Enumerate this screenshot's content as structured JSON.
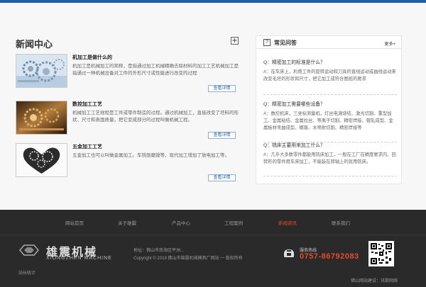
{
  "news": {
    "title": "新闻中心",
    "plus_symbol": "+",
    "items": [
      {
        "title": "机加工是做什么的",
        "description": "机加工是机械加工的简称，是指通过加工机械精确去除材料的加工工艺机械加工是指通过一种机械设备对工件的外形尺寸或性能进行改变的过程",
        "more_label": "查看详情"
      },
      {
        "title": "数控加工工艺",
        "description": "机械加工工艺规程是工件或零件制造的过程。通过机械加工，直接改变了坯料的形状、尺寸和表面质量，把它变成部分的过程叫做机械工程。",
        "more_label": "查看详情"
      },
      {
        "title": "五金加工工艺",
        "description": "五金加工也可以叫做金属加工。车铣刨磨镗等，现代加工增加了放电加工等。",
        "more_label": "查看详情"
      }
    ]
  },
  "faq": {
    "icon_symbol": "?",
    "title": "常见问答",
    "more_label": "更多+",
    "items": [
      {
        "question": "Q：精密加工的标准是什么？",
        "answer": "A：在车床上，利用工件的旋转运动和刀具的直线运动或曲线运动来改变毛坯的形状和尺寸，把它加工成符合图纸的要求"
      },
      {
        "question": "Q：精密加工需要哪些设备？",
        "answer": "A：数控机床，三坐标测量机，灯丝电源烧结、激光切割、重型加工、金属粘结、金属拉丝、等离子切割、精密焊接、辊轧成型、金属板材弯曲成型、模锻、水喷射切割、精密焊接等"
      },
      {
        "question": "Q：铣床主要用来加工什么？",
        "answer": "A：几乎大多数零件都能用铣床加工，一般在工厂在精度要求内，回转形的零件用车床加工，不能装在转轴上的就用铣床。"
      }
    ]
  },
  "footer": {
    "nav": [
      {
        "label": "网站首页",
        "active": false
      },
      {
        "label": "关于雄震",
        "active": false
      },
      {
        "label": "产品中心",
        "active": false
      },
      {
        "label": "工程案例",
        "active": false
      },
      {
        "label": "新闻资讯",
        "active": true
      },
      {
        "label": "联系我们",
        "active": false
      }
    ],
    "logo_cn": "雄震机械",
    "logo_en": "XIONGZHEN MACHINE",
    "address": "地址：佛山市南海区平洲...",
    "copyright": "Copyright © 2018  佛山市雄震机械模具厂网站  一 版权所有",
    "hotline_label": "服务热线",
    "hotline_number": "0757-86792083",
    "credit": "佛山网站建设：讯歌网络",
    "stats": "站长统计",
    "colors": {
      "accent": "#e74a2b",
      "background": "#2a2a2a",
      "brand_blue": "#1f5fa8"
    }
  }
}
